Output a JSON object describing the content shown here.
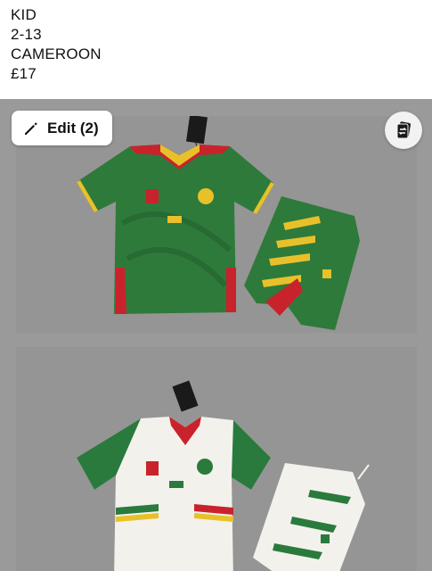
{
  "caption": {
    "lines": [
      "KID",
      "2-13",
      "CAMEROON",
      "£17"
    ]
  },
  "toolbar": {
    "edit_label": "Edit (2)",
    "edit_icon": "pencil-icon",
    "swap_icon": "swap-cards-icon"
  },
  "photos": [
    {
      "label": "green-kit",
      "jersey_color": "#2e7a3a",
      "collar_color": "#e8c12a",
      "trim_red": "#c8232c"
    },
    {
      "label": "white-kit",
      "jersey_color": "#f3f1ec",
      "sleeve_color": "#2a7a3e",
      "trim_red": "#c8232c"
    }
  ]
}
